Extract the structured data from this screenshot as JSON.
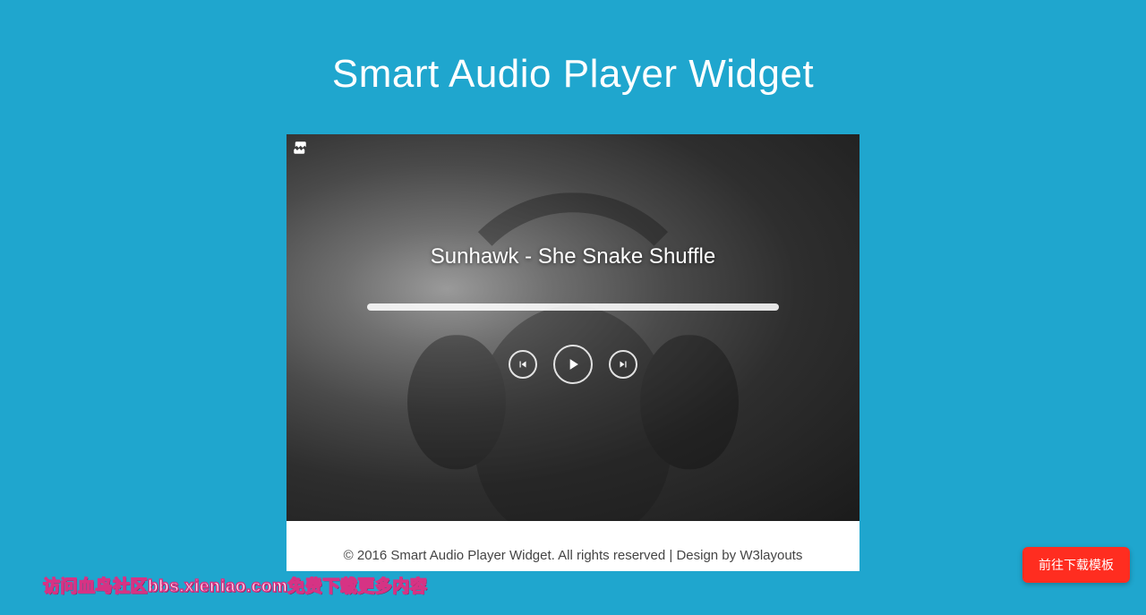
{
  "page": {
    "title": "Smart Audio Player Widget"
  },
  "player": {
    "track_title": "Sunhawk - She Snake Shuffle",
    "progress_percent": 0
  },
  "controls": {
    "prev_label": "previous",
    "play_label": "play",
    "next_label": "next"
  },
  "footer": {
    "copyright_prefix": "© 2016 Smart Audio Player Widget. All rights reserved | Design by ",
    "design_link_text": "W3layouts"
  },
  "download_button": {
    "label": "前往下载模板"
  },
  "watermark": {
    "text": "访问血鸟社区bbs.xieniao.com免费下载更多内容"
  }
}
